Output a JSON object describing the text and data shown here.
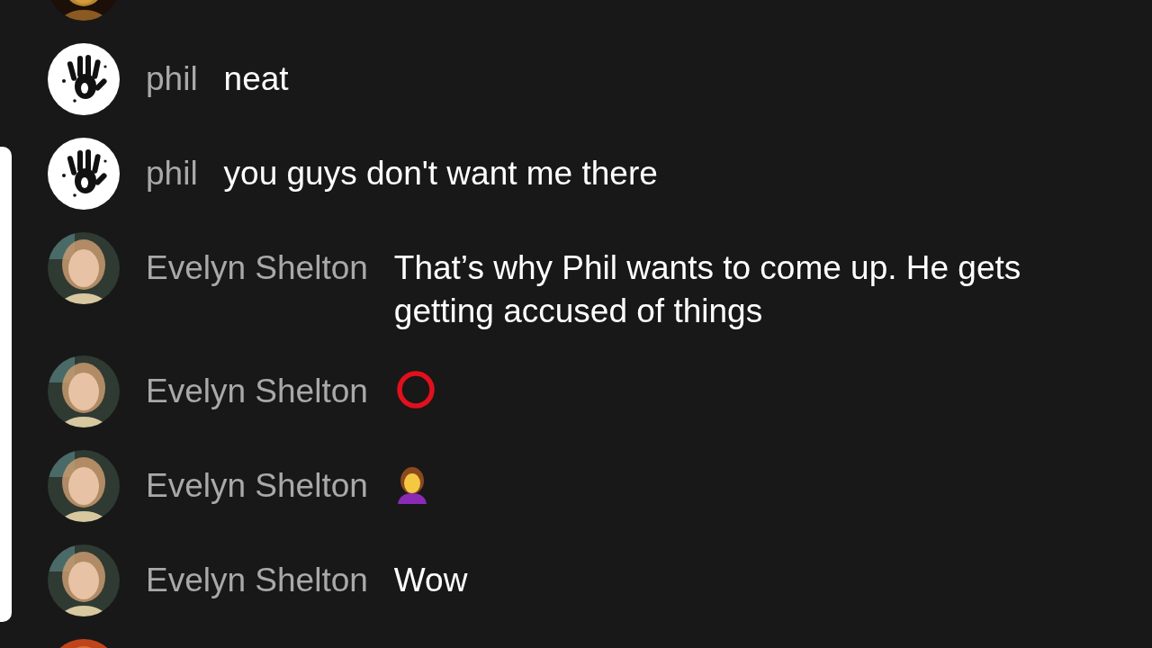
{
  "messages": [
    {
      "avatar": {
        "kind": "photo_dark"
      }
    },
    {
      "author": "phil",
      "avatar": {
        "kind": "handprint"
      },
      "parts": [
        {
          "kind": "text",
          "text": "neat"
        }
      ]
    },
    {
      "author": "phil",
      "avatar": {
        "kind": "handprint"
      },
      "parts": [
        {
          "kind": "text",
          "text": "you guys don't want me there"
        }
      ]
    },
    {
      "author": "Evelyn Shelton",
      "avatar": {
        "kind": "photo_person"
      },
      "parts": [
        {
          "kind": "text",
          "text": "That’s why Phil wants to come up. He gets getting accused of things"
        }
      ]
    },
    {
      "author": "Evelyn Shelton",
      "avatar": {
        "kind": "photo_person"
      },
      "parts": [
        {
          "kind": "ring_emoji"
        }
      ]
    },
    {
      "author": "Evelyn Shelton",
      "avatar": {
        "kind": "photo_person"
      },
      "parts": [
        {
          "kind": "woman_emoji"
        }
      ]
    },
    {
      "author": "Evelyn Shelton",
      "avatar": {
        "kind": "photo_person"
      },
      "parts": [
        {
          "kind": "text",
          "text": "Wow"
        }
      ]
    },
    {
      "avatar": {
        "kind": "photo_orange"
      }
    }
  ]
}
